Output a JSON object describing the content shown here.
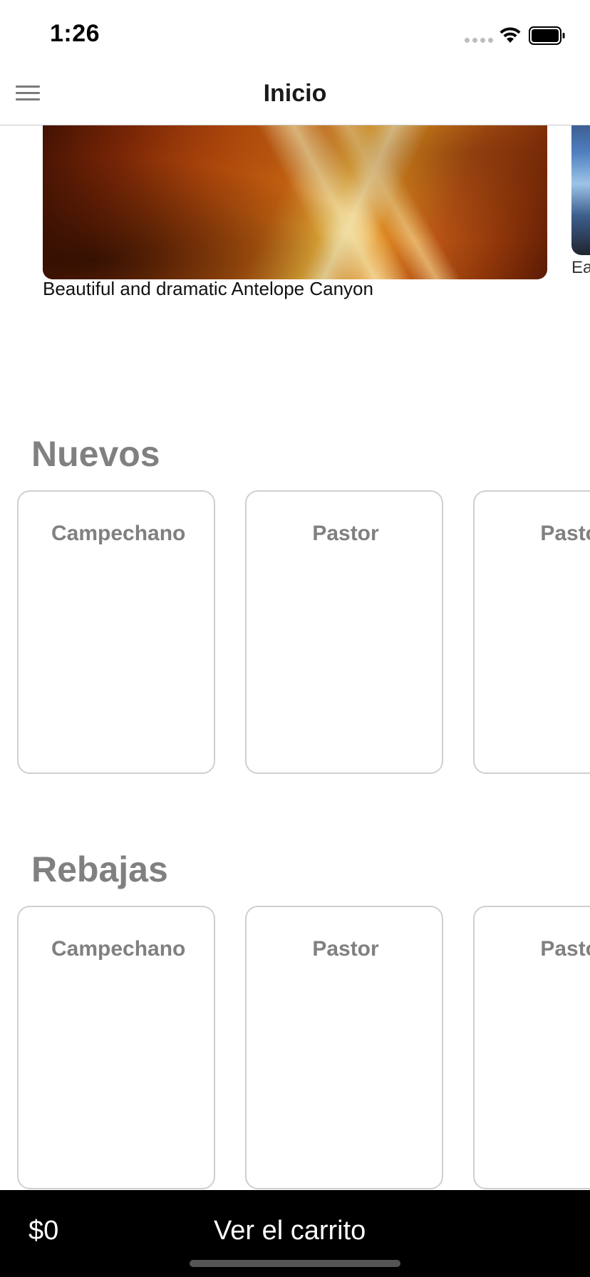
{
  "status_bar": {
    "time": "1:26"
  },
  "nav": {
    "title": "Inicio"
  },
  "carousel": {
    "items": [
      {
        "caption": "Beautiful and dramatic Antelope Canyon"
      },
      {
        "caption": "Ea"
      }
    ]
  },
  "sections": {
    "nuevos": {
      "title": "Nuevos",
      "products": [
        "Campechano",
        "Pastor",
        "Pastor"
      ]
    },
    "rebajas": {
      "title": "Rebajas",
      "products": [
        "Campechano",
        "Pastor",
        "Pastor"
      ]
    }
  },
  "cart": {
    "total": "$0",
    "button_label": "Ver el carrito"
  }
}
